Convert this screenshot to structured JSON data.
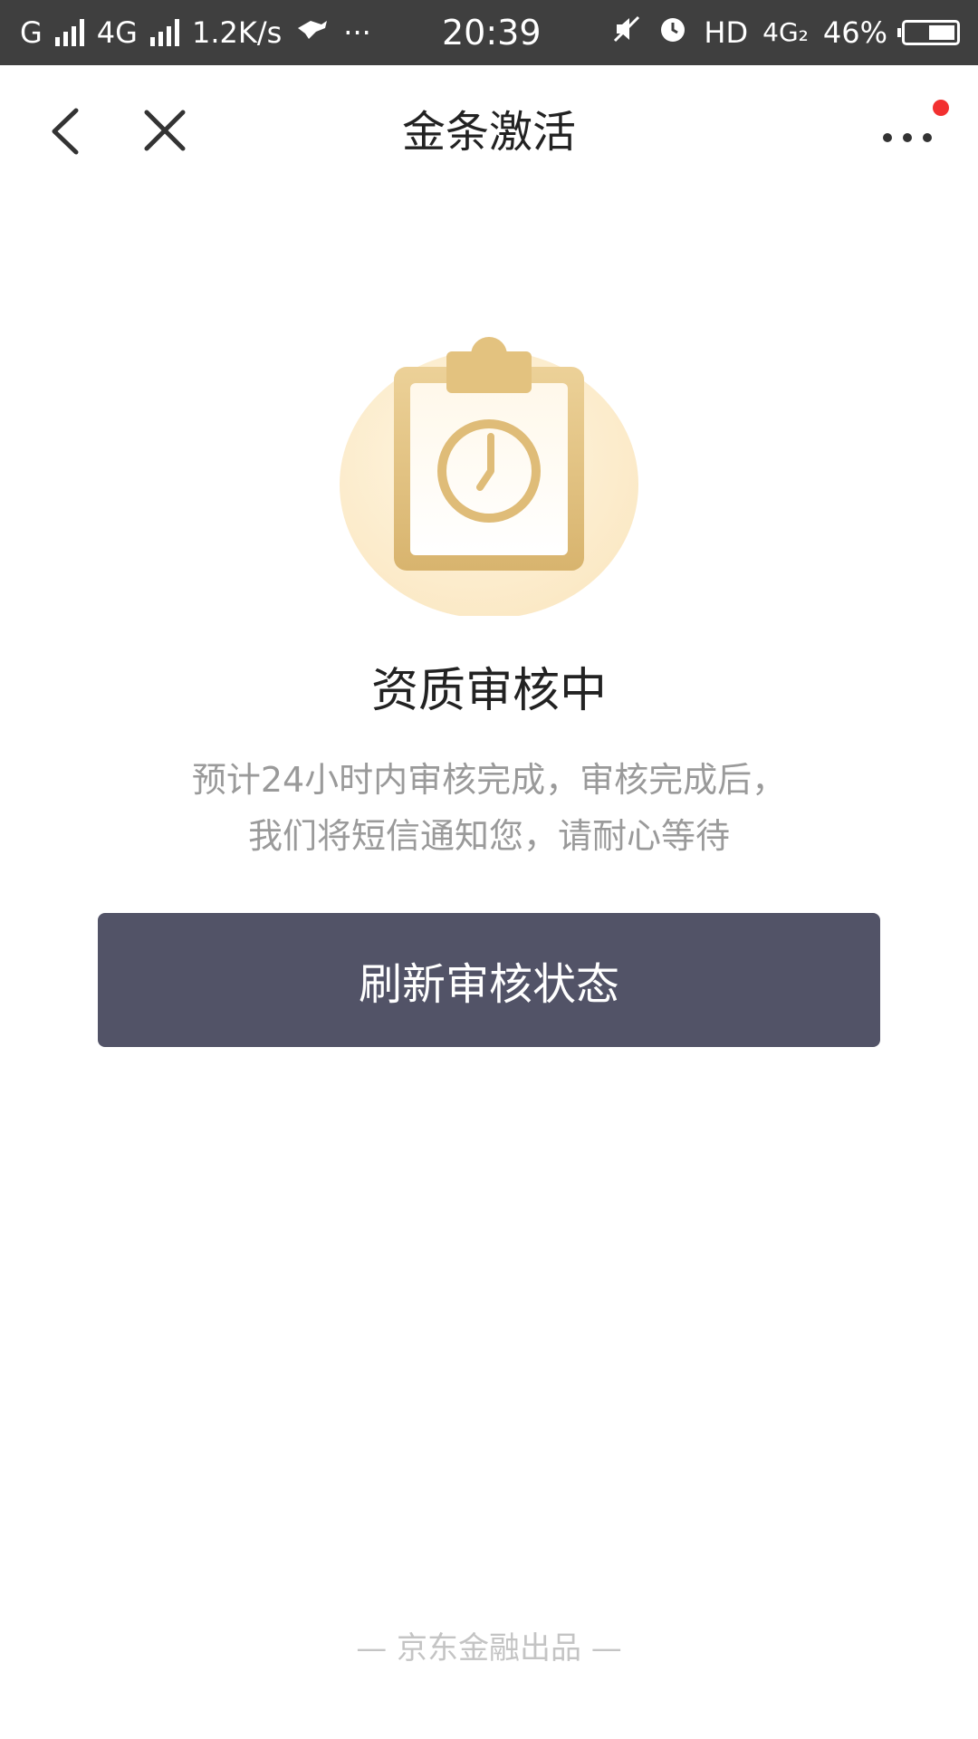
{
  "status_bar": {
    "carrier1": "G",
    "carrier2": "4G",
    "speed": "1.2K/s",
    "more": "···",
    "time": "20:39",
    "hd": "HD",
    "net": "4G₂",
    "battery": "46%"
  },
  "nav": {
    "title": "金条激活",
    "icons": [
      "back-arrow-icon",
      "close-icon",
      "more-icon"
    ]
  },
  "main": {
    "title": "资质审核中",
    "desc_line1": "预计24小时内审核完成，审核完成后，",
    "desc_line2": "我们将短信通知您，请耐心等待",
    "refresh_label": "刷新审核状态"
  },
  "footer": {
    "text": "— 京东金融出品 —"
  },
  "colors": {
    "status_bar": "#3f3f3f",
    "button": "#525367",
    "accent_gold": "#d9b46a",
    "notification_dot": "#f23030"
  }
}
